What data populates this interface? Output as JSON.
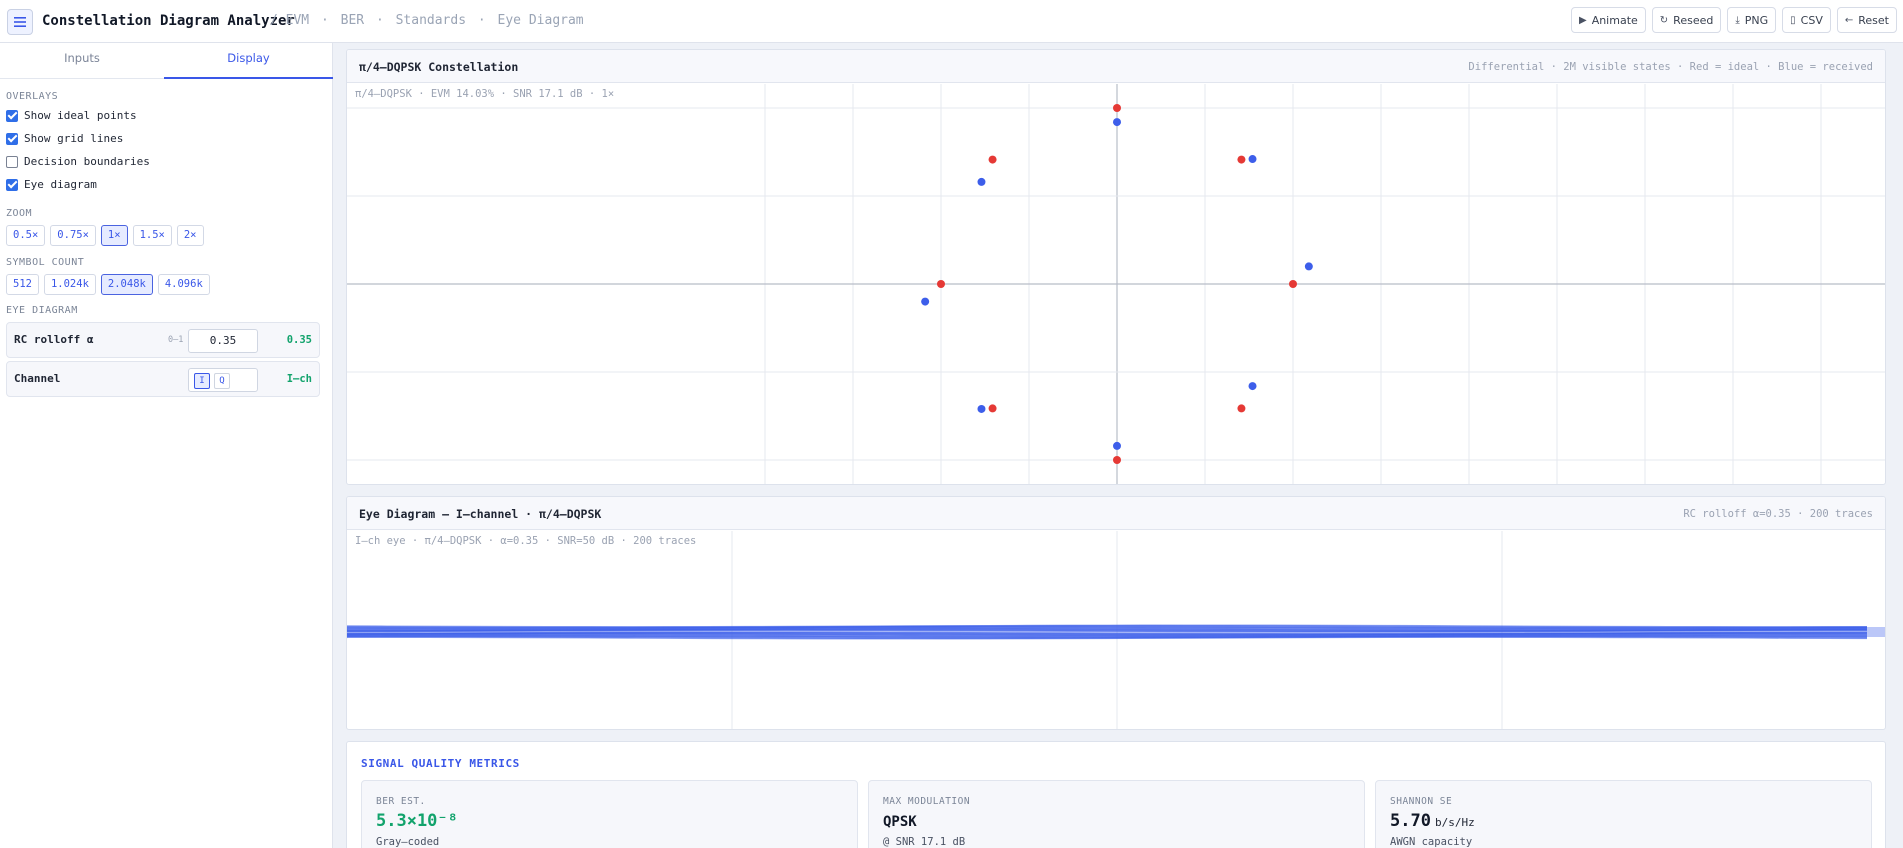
{
  "app": {
    "title": "Constellation Diagram Analyzer",
    "breadcrumbs": [
      "/ EVM",
      "·",
      "BER",
      "·",
      "Standards",
      "·",
      "Eye Diagram"
    ]
  },
  "toolbar": {
    "animate": "Animate",
    "reseed": "Reseed",
    "png": "PNG",
    "csv": "CSV",
    "reset": "Reset"
  },
  "sidebar": {
    "tabs": [
      {
        "label": "Inputs",
        "active": false
      },
      {
        "label": "Display",
        "active": true
      }
    ],
    "overlays_label": "OVERLAYS",
    "overlays": [
      {
        "label": "Show ideal points",
        "checked": true
      },
      {
        "label": "Show grid lines",
        "checked": true
      },
      {
        "label": "Decision boundaries",
        "checked": false
      },
      {
        "label": "Eye diagram",
        "checked": true
      }
    ],
    "zoom_label": "ZOOM",
    "zoom_options": [
      "0.5×",
      "0.75×",
      "1×",
      "1.5×",
      "2×"
    ],
    "zoom_selected": "1×",
    "symbol_label": "SYMBOL COUNT",
    "symbol_options": [
      "512",
      "1.024k",
      "2.048k",
      "4.096k"
    ],
    "symbol_selected": "2.048k",
    "eye_label": "EYE DIAGRAM",
    "rolloff": {
      "name": "RC rolloff α",
      "range": "0–1",
      "input": "0.35",
      "value": "0.35"
    },
    "channel": {
      "name": "Channel",
      "opt_i": "I",
      "opt_q": "Q",
      "selected": "I",
      "value": "I–ch"
    }
  },
  "constellation": {
    "title": "π/4–DQPSK Constellation",
    "meta": "Differential · 2M visible states · Red = ideal · Blue = received",
    "caption": "π/4–DQPSK  ·  EVM 14.03%  ·  SNR 17.1 dB  ·  1×",
    "ideal_color": "#e53935",
    "received_color": "#3d5eea"
  },
  "chart_data": {
    "type": "scatter",
    "series": [
      {
        "name": "ideal",
        "values": [
          [
            0,
            1
          ],
          [
            0.707,
            0.707
          ],
          [
            1,
            0
          ],
          [
            0.707,
            -0.707
          ],
          [
            0,
            -1
          ],
          [
            -0.707,
            -0.707
          ],
          [
            -1,
            0
          ],
          [
            -0.707,
            0.707
          ]
        ]
      },
      {
        "name": "received",
        "values": [
          [
            0,
            0.92
          ],
          [
            0.77,
            0.71
          ],
          [
            1.09,
            0.1
          ],
          [
            0.77,
            -0.58
          ],
          [
            0,
            -0.92
          ],
          [
            -0.77,
            -0.71
          ],
          [
            -1.09,
            -0.1
          ],
          [
            -0.77,
            0.58
          ]
        ]
      }
    ],
    "grid": true
  },
  "eye": {
    "title": "Eye Diagram — I–channel · π/4–DQPSK",
    "meta": "RC rolloff α=0.35 · 200 traces",
    "caption": "I–ch eye · π/4–DQPSK · α=0.35 · SNR=50 dB · 200 traces",
    "trace_color": "#3d5eea"
  },
  "metrics": {
    "title": "SIGNAL QUALITY METRICS",
    "cards": [
      {
        "label": "BER EST.",
        "value": "5.3×10⁻⁸",
        "unit": "",
        "sub": "Gray–coded",
        "color": "#12a36c"
      },
      {
        "label": "MAX MODULATION",
        "value": "QPSK",
        "unit": "",
        "sub": "@ SNR 17.1 dB",
        "color": "#111827"
      },
      {
        "label": "SHANNON SE",
        "value": "5.70",
        "unit": "b/s/Hz",
        "sub": "AWGN capacity",
        "color": "#111827"
      }
    ]
  }
}
